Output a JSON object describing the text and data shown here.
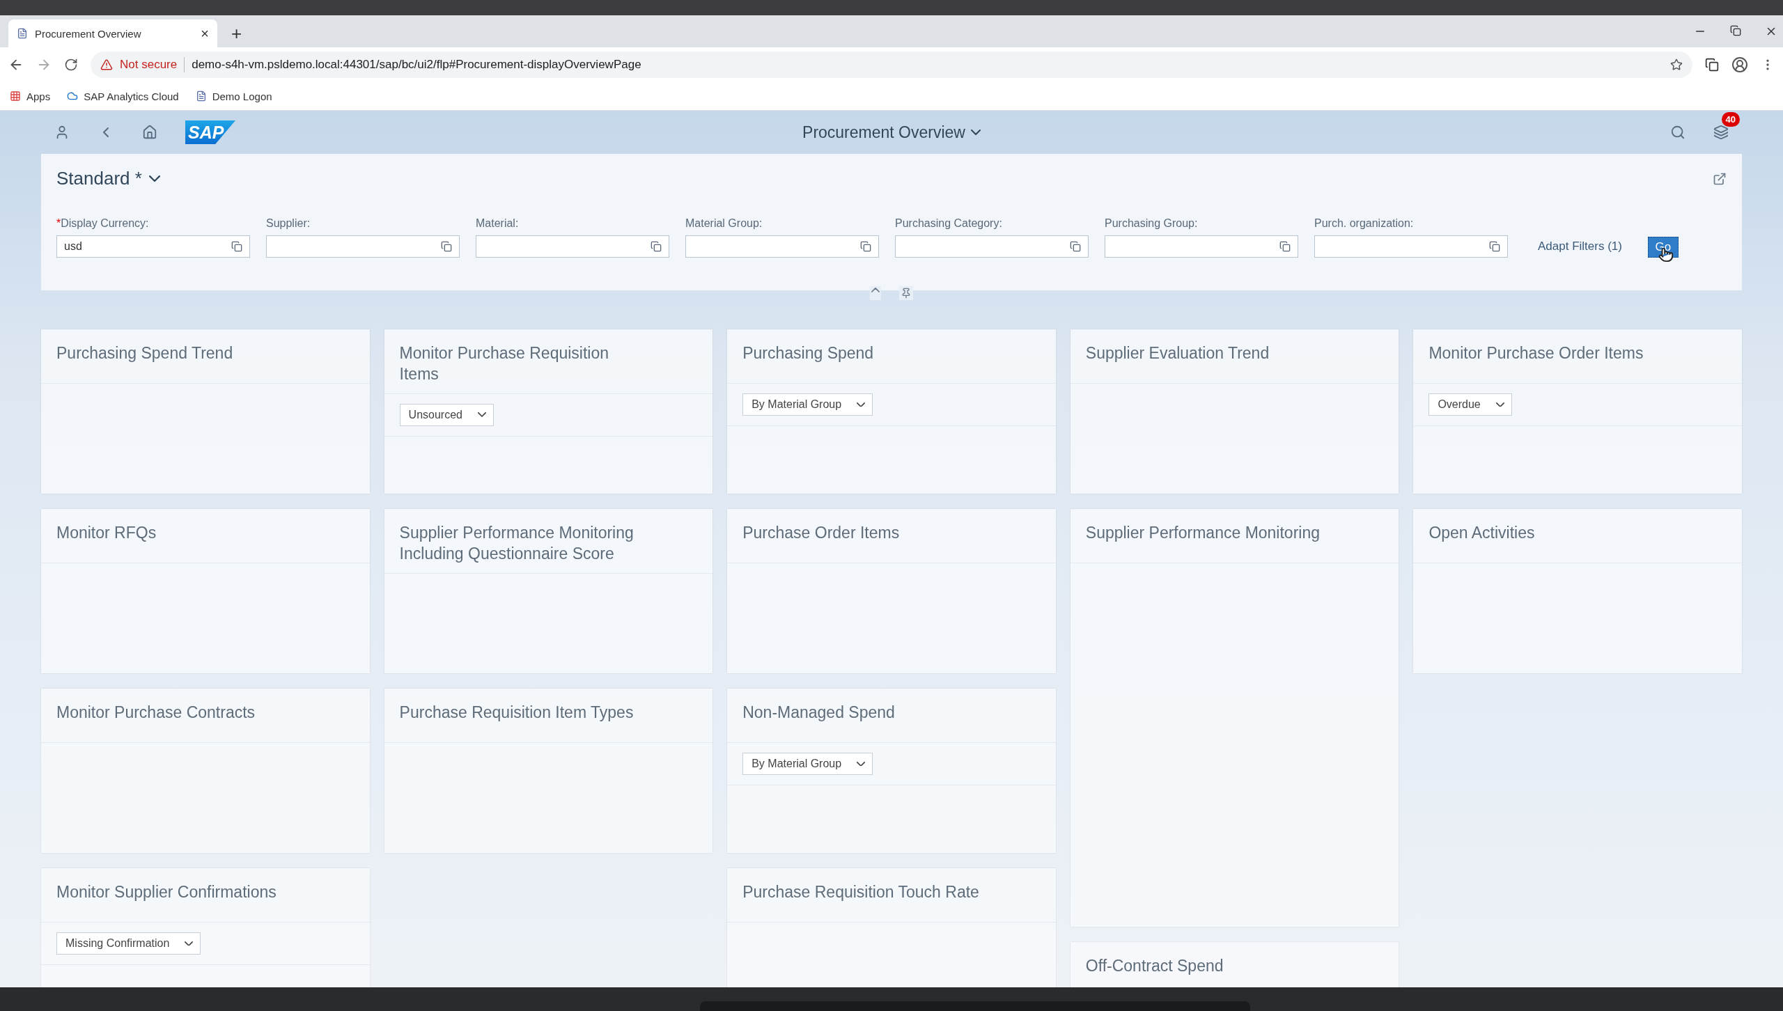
{
  "browser": {
    "tab": {
      "title": "Procurement Overview",
      "close": "×"
    },
    "new_tab": "+",
    "address": {
      "security": "Not secure",
      "url": "demo-s4h-vm.psldemo.local:44301/sap/bc/ui2/flp#Procurement-displayOverviewPage"
    },
    "bookmarks": [
      {
        "label": "Apps",
        "kind": "apps"
      },
      {
        "label": "SAP Analytics Cloud",
        "kind": "sap"
      },
      {
        "label": "Demo Logon",
        "kind": "page"
      }
    ]
  },
  "shell": {
    "logo": "SAP",
    "title": "Procurement Overview",
    "notification_count": "40"
  },
  "filter_bar": {
    "variant": "Standard *",
    "fields": [
      {
        "label": "Display Currency:",
        "required_mark": "*",
        "value": "usd"
      },
      {
        "label": "Supplier:"
      },
      {
        "label": "Material:"
      },
      {
        "label": "Material Group:"
      },
      {
        "label": "Purchasing Category:"
      },
      {
        "label": "Purchasing Group:"
      },
      {
        "label": "Purch. organization:"
      }
    ],
    "adapt_filters": "Adapt Filters (1)",
    "go": "Go"
  },
  "columns": [
    [
      {
        "title": "Purchasing Spend Trend",
        "kind": "standard"
      },
      {
        "title": "Monitor RFQs",
        "kind": "standard"
      },
      {
        "title": "Monitor Purchase Contracts",
        "kind": "standard"
      },
      {
        "title": "Monitor Supplier Confirmations",
        "kind": "standard",
        "dropdown": "Missing Confirmation"
      }
    ],
    [
      {
        "title": "Monitor Purchase Requisition Items",
        "kind": "standard",
        "dropdown": "Unsourced"
      },
      {
        "title": "Supplier Performance Monitoring Including Questionnaire Score",
        "kind": "standard"
      },
      {
        "title": "Purchase Requisition Item Types",
        "kind": "standard"
      }
    ],
    [
      {
        "title": "Purchasing Spend",
        "kind": "standard",
        "dropdown": "By Material Group"
      },
      {
        "title": "Purchase Order Items",
        "kind": "standard"
      },
      {
        "title": "Non-Managed Spend",
        "kind": "standard",
        "dropdown": "By Material Group"
      },
      {
        "title": "Purchase Requisition Touch Rate",
        "kind": "standard"
      }
    ],
    [
      {
        "title": "Supplier Evaluation Trend",
        "kind": "standard"
      },
      {
        "title": "Supplier Performance Monitoring",
        "kind": "tall"
      },
      {
        "title": "Off-Contract Spend",
        "kind": "standard"
      }
    ],
    [
      {
        "title": "Monitor Purchase Order Items",
        "kind": "standard",
        "dropdown": "Overdue"
      },
      {
        "title": "Open Activities",
        "kind": "standard"
      }
    ]
  ]
}
